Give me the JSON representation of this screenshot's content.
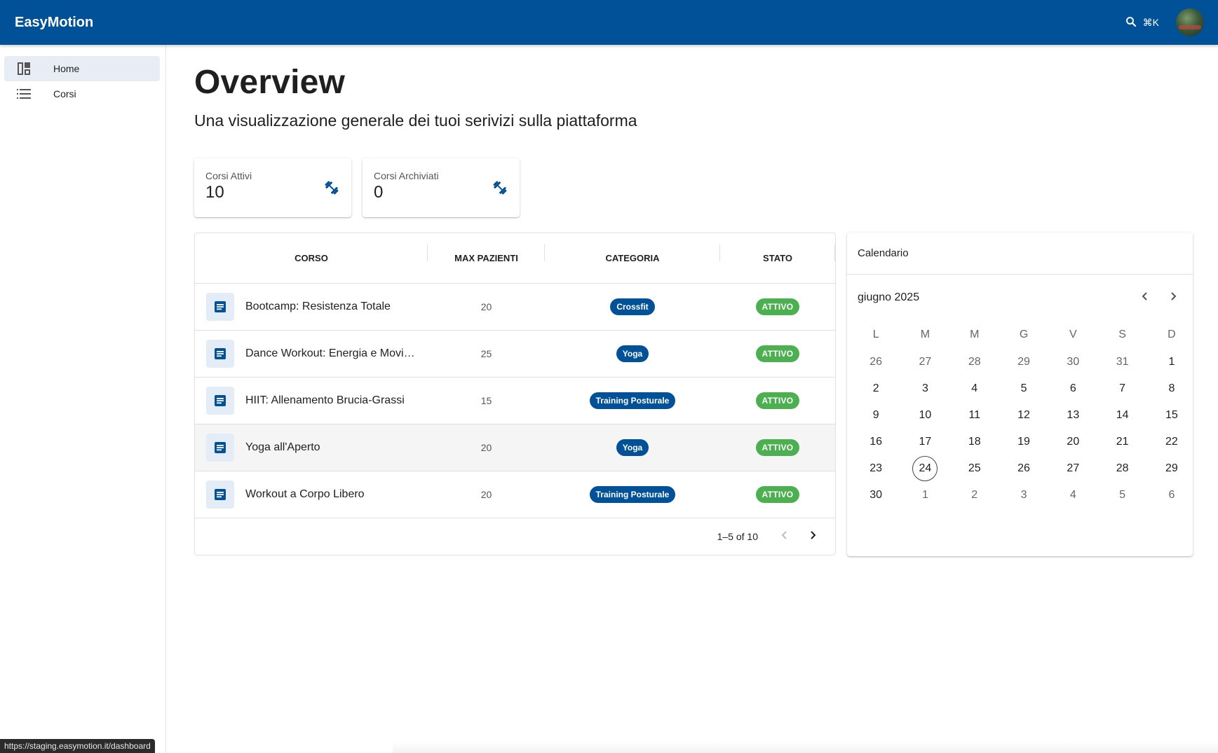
{
  "appbar": {
    "brand": "EasyMotion",
    "shortcut": "⌘K",
    "colors": {
      "primary": "#005197"
    }
  },
  "sidebar": {
    "items": [
      {
        "label": "Home",
        "icon": "dashboard-icon",
        "active": true
      },
      {
        "label": "Corsi",
        "icon": "list-icon",
        "active": false
      }
    ]
  },
  "page": {
    "title": "Overview",
    "subtitle": "Una visualizzazione generale dei tuoi serivizi sulla piattaforma"
  },
  "stats": [
    {
      "label": "Corsi Attivi",
      "value": "10",
      "icon": "dumbbell-icon"
    },
    {
      "label": "Corsi Archiviati",
      "value": "0",
      "icon": "dumbbell-icon"
    }
  ],
  "table": {
    "columns": [
      "CORSO",
      "MAX PAZIENTI",
      "CATEGORIA",
      "STATO"
    ],
    "rows": [
      {
        "corso": "Bootcamp: Resistenza Totale",
        "max": "20",
        "categoria": "Crossfit",
        "stato": "ATTIVO"
      },
      {
        "corso": "Dance Workout: Energia e Movimento",
        "max": "25",
        "categoria": "Yoga",
        "stato": "ATTIVO"
      },
      {
        "corso": "HIIT: Allenamento Brucia-Grassi",
        "max": "15",
        "categoria": "Training Posturale",
        "stato": "ATTIVO"
      },
      {
        "corso": "Yoga all'Aperto",
        "max": "20",
        "categoria": "Yoga",
        "stato": "ATTIVO"
      },
      {
        "corso": "Workout a Corpo Libero",
        "max": "20",
        "categoria": "Training Posturale",
        "stato": "ATTIVO"
      }
    ],
    "pagination": "1–5 of 10",
    "colors": {
      "category_chip": "#005197",
      "status_chip": "#4caf50"
    }
  },
  "calendar": {
    "title": "Calendario",
    "month": "giugno 2025",
    "weekdays": [
      "L",
      "M",
      "M",
      "G",
      "V",
      "S",
      "D"
    ],
    "weeks": [
      [
        "26",
        "27",
        "28",
        "29",
        "30",
        "31",
        "1"
      ],
      [
        "2",
        "3",
        "4",
        "5",
        "6",
        "7",
        "8"
      ],
      [
        "9",
        "10",
        "11",
        "12",
        "13",
        "14",
        "15"
      ],
      [
        "16",
        "17",
        "18",
        "19",
        "20",
        "21",
        "22"
      ],
      [
        "23",
        "24",
        "25",
        "26",
        "27",
        "28",
        "29"
      ],
      [
        "30",
        "1",
        "2",
        "3",
        "4",
        "5",
        "6"
      ]
    ],
    "today": "24"
  },
  "statusbar": {
    "url": "https://staging.easymotion.it/dashboard"
  }
}
